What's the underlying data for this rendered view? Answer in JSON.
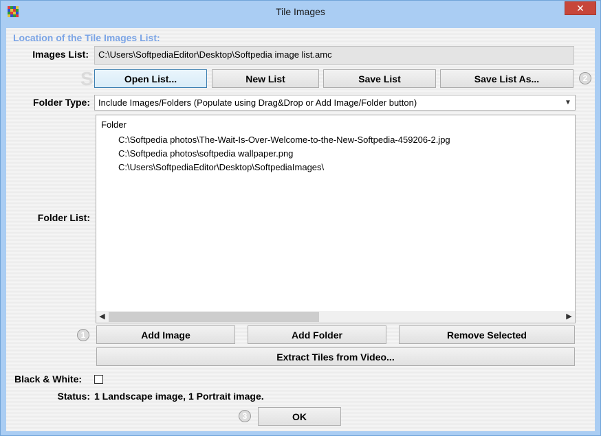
{
  "window": {
    "title": "Tile Images",
    "close_label": "✕"
  },
  "location": {
    "group_title": "Location of the Tile Images List:",
    "images_list_label": "Images List:",
    "images_list_value": "C:\\Users\\SoftpediaEditor\\Desktop\\Softpedia image list.amc",
    "buttons": {
      "open": "Open List...",
      "new": "New List",
      "save": "Save List",
      "save_as": "Save List As..."
    },
    "step_badge": "2"
  },
  "folder_type": {
    "label": "Folder Type:",
    "selected": "Include Images/Folders (Populate using Drag&Drop or Add Image/Folder button)"
  },
  "folder_list": {
    "label": "Folder List:",
    "column_header": "Folder",
    "items": [
      "C:\\Softpedia photos\\The-Wait-Is-Over-Welcome-to-the-New-Softpedia-459206-2.jpg",
      "C:\\Softpedia photos\\softpedia wallpaper.png",
      "C:\\Users\\SoftpediaEditor\\Desktop\\SoftpediaImages\\"
    ]
  },
  "actions": {
    "step_badge": "1",
    "add_image": "Add Image",
    "add_folder": "Add Folder",
    "remove_selected": "Remove Selected",
    "extract_tiles": "Extract Tiles from Video..."
  },
  "options": {
    "black_white_label": "Black & White:",
    "black_white_checked": false
  },
  "status": {
    "label": "Status:",
    "value": "1 Landscape image, 1 Portrait image."
  },
  "footer": {
    "step_badge": "3",
    "ok": "OK"
  },
  "watermark": "SOFTPEDIA",
  "colors": {
    "titlebar": "#aacdf3",
    "group_title": "#7aa4e6",
    "close_button": "#c7463a"
  }
}
